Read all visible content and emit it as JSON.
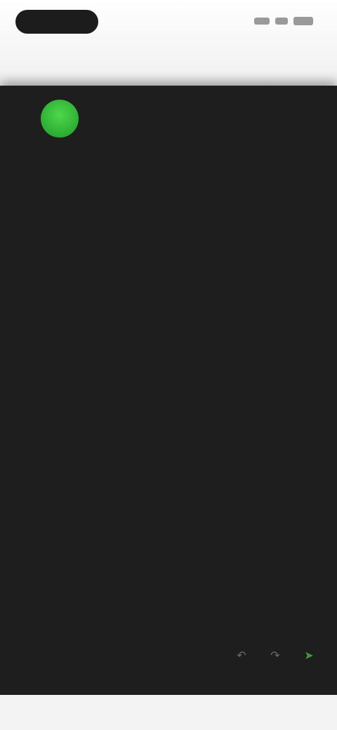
{
  "status_bar": {
    "time": "",
    "signal_icon": "signal-icon",
    "wifi_icon": "wifi-icon",
    "battery_icon": "battery-icon"
  },
  "message": {
    "sender": "",
    "paragraphs": [
      "",
      ""
    ],
    "quoted": "",
    "reply": "",
    "footer": ""
  },
  "actions": [
    {
      "icon": "reply-icon"
    },
    {
      "icon": "forward-icon"
    },
    {
      "icon": "send-icon"
    }
  ],
  "colors": {
    "background": "#1e1e1e",
    "accent": "#3f9b3a",
    "text": "#bdbdbd"
  }
}
